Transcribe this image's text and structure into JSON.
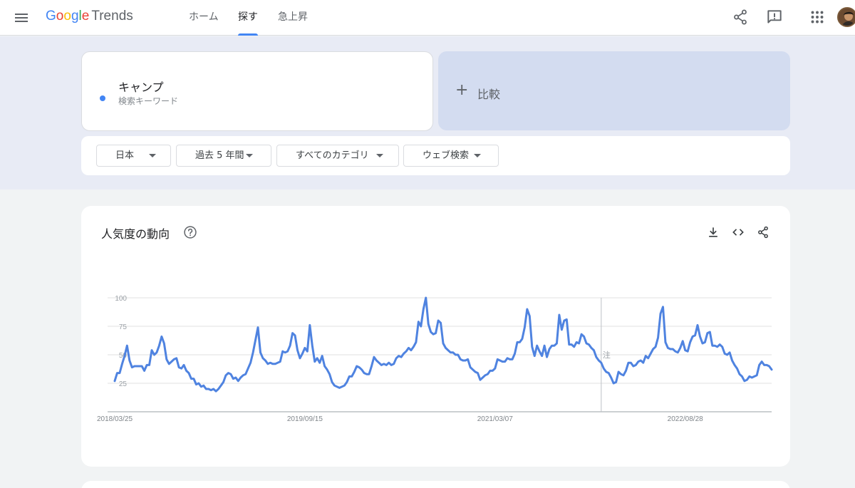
{
  "header": {
    "logo": {
      "google": "Google",
      "product": "Trends"
    },
    "tabs": [
      {
        "label": "ホーム",
        "active": false
      },
      {
        "label": "探す",
        "active": true
      },
      {
        "label": "急上昇",
        "active": false
      }
    ],
    "icons": [
      "menu-icon",
      "share-icon",
      "feedback-icon",
      "apps-icon",
      "avatar"
    ]
  },
  "search": {
    "term": "キャンプ",
    "term_type": "検索キーワード",
    "term_color": "#4285f4",
    "compare_label": "比較"
  },
  "filters": [
    {
      "label": "日本"
    },
    {
      "label": "過去 5 年間"
    },
    {
      "label": "すべてのカテゴリ"
    },
    {
      "label": "ウェブ検索"
    }
  ],
  "chart_card": {
    "title": "人気度の動向",
    "icons": [
      "help-icon",
      "download-icon",
      "embed-icon",
      "share-icon"
    ]
  },
  "chart_data": {
    "type": "line",
    "title": "",
    "xlabel": "",
    "ylabel": "",
    "ylim": [
      0,
      100
    ],
    "y_ticks": [
      25,
      50,
      75,
      100
    ],
    "x_ticks": [
      "2018/03/25",
      "2019/09/15",
      "2021/03/07",
      "2022/08/28"
    ],
    "x_tick_indices": [
      0,
      77,
      154,
      231
    ],
    "annotation": {
      "label": "注",
      "index": 197
    },
    "grid": true,
    "series": [
      {
        "color": "#4f83e0",
        "values": [
          27,
          34,
          34,
          42,
          49,
          58,
          45,
          39,
          40,
          40,
          40,
          40,
          36,
          41,
          41,
          54,
          50,
          52,
          58,
          66,
          60,
          46,
          42,
          44,
          46,
          47,
          39,
          38,
          41,
          36,
          34,
          29,
          29,
          24,
          25,
          22,
          23,
          20,
          20,
          19,
          20,
          18,
          20,
          23,
          26,
          32,
          34,
          33,
          29,
          30,
          27,
          30,
          32,
          33,
          38,
          43,
          52,
          63,
          74,
          52,
          47,
          45,
          42,
          43,
          42,
          42,
          43,
          44,
          53,
          52,
          53,
          58,
          69,
          67,
          54,
          47,
          51,
          56,
          53,
          76,
          58,
          44,
          47,
          43,
          49,
          40,
          37,
          33,
          26,
          23,
          22,
          21,
          22,
          23,
          26,
          31,
          31,
          35,
          40,
          39,
          37,
          34,
          33,
          33,
          40,
          48,
          45,
          43,
          41,
          42,
          41,
          43,
          41,
          42,
          47,
          49,
          48,
          51,
          53,
          56,
          54,
          57,
          61,
          79,
          75,
          90,
          100,
          77,
          70,
          68,
          69,
          80,
          78,
          60,
          56,
          54,
          52,
          52,
          50,
          50,
          46,
          45,
          45,
          46,
          39,
          37,
          35,
          34,
          28,
          30,
          32,
          33,
          36,
          36,
          38,
          46,
          45,
          44,
          44,
          47,
          46,
          46,
          51,
          61,
          61,
          64,
          74,
          90,
          84,
          57,
          49,
          58,
          53,
          49,
          58,
          48,
          55,
          58,
          58,
          60,
          85,
          72,
          80,
          81,
          59,
          59,
          57,
          61,
          60,
          68,
          66,
          60,
          59,
          56,
          54,
          48,
          45,
          43,
          38,
          35,
          34,
          30,
          25,
          26,
          35,
          33,
          32,
          36,
          43,
          43,
          40,
          41,
          44,
          45,
          43,
          49,
          47,
          51,
          55,
          57,
          65,
          86,
          92,
          61,
          56,
          55,
          55,
          53,
          52,
          56,
          62,
          54,
          53,
          61,
          66,
          67,
          76,
          66,
          60,
          61,
          69,
          70,
          58,
          58,
          57,
          59,
          57,
          51,
          50,
          52,
          45,
          41,
          38,
          33,
          31,
          27,
          28,
          31,
          30,
          31,
          32,
          41,
          44,
          41,
          41,
          40,
          37
        ]
      }
    ]
  }
}
